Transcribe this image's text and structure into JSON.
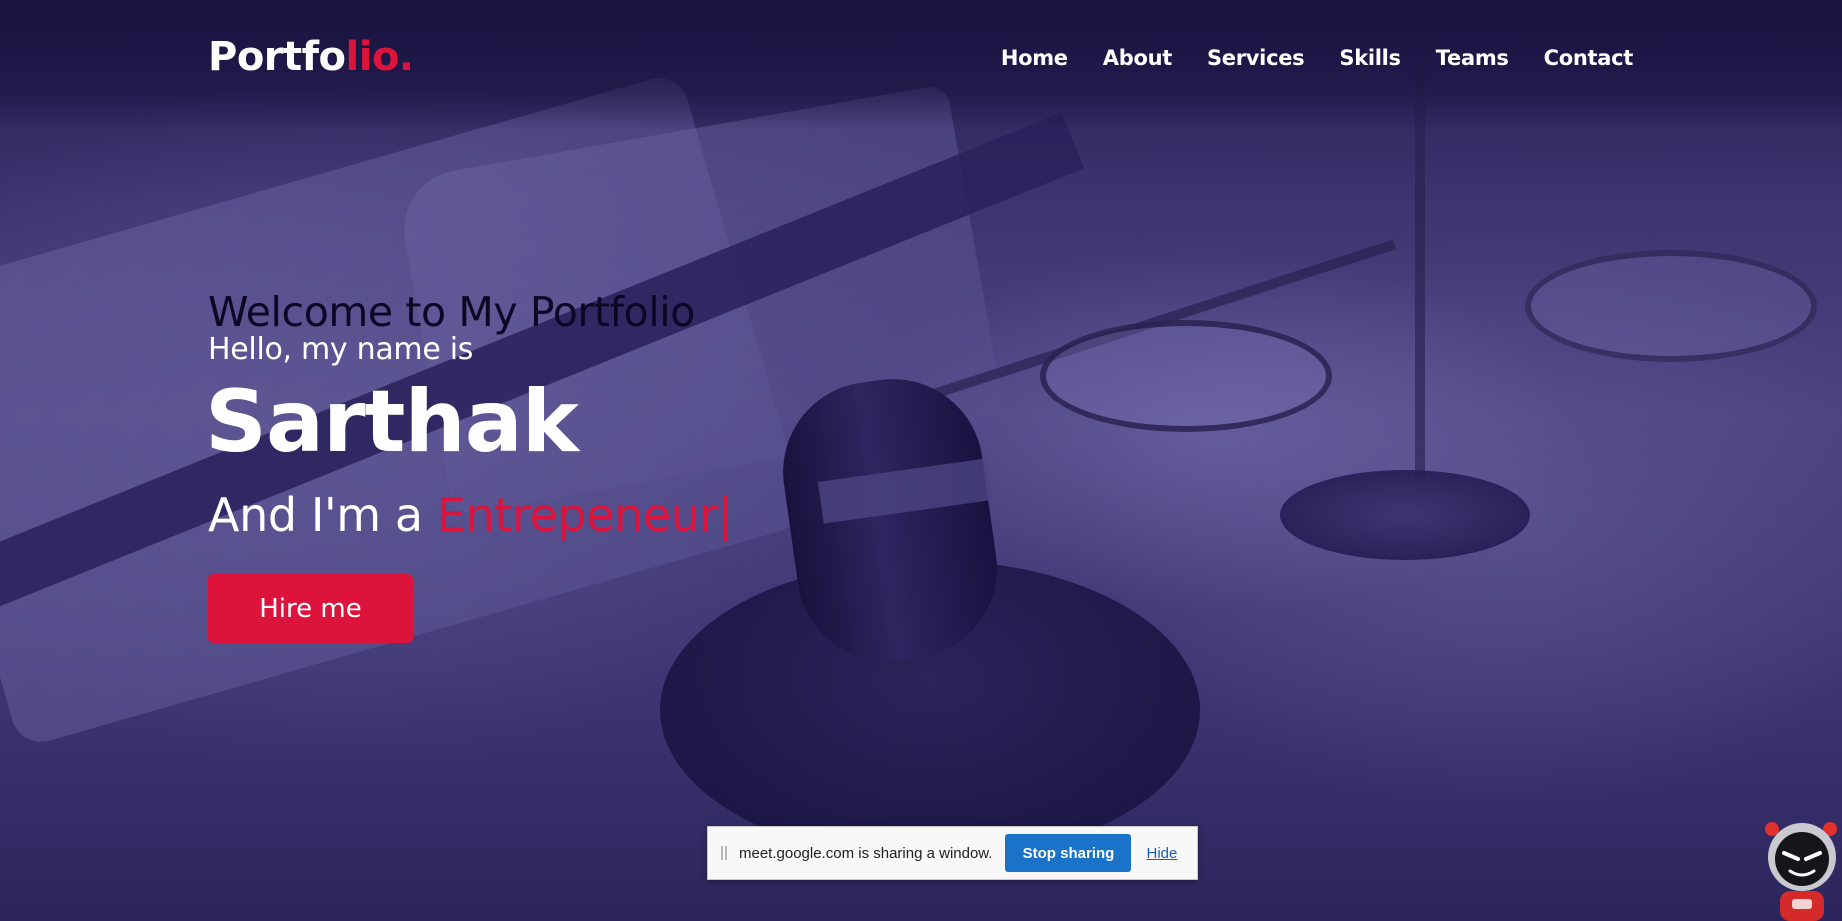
{
  "navbar": {
    "logo_main": "Portfo",
    "logo_accent": "lio.",
    "links": [
      "Home",
      "About",
      "Services",
      "Skills",
      "Teams",
      "Contact"
    ]
  },
  "hero": {
    "welcome": "Welcome to My Portfolio",
    "greeting": "Hello, my name is",
    "name": "Sarthak",
    "role_prefix": "And I'm a ",
    "role": "Entrepeneur",
    "cursor": "|",
    "hire_button": "Hire me"
  },
  "share_bar": {
    "message": "meet.google.com is sharing a window.",
    "stop_button": "Stop sharing",
    "hide_link": "Hide"
  },
  "colors": {
    "accent": "#dc143c",
    "background": "#2c255d",
    "share_button": "#1a73c8"
  },
  "icons": {
    "mascot": "robot-mascot-icon",
    "grip": "drag-grip-icon"
  }
}
